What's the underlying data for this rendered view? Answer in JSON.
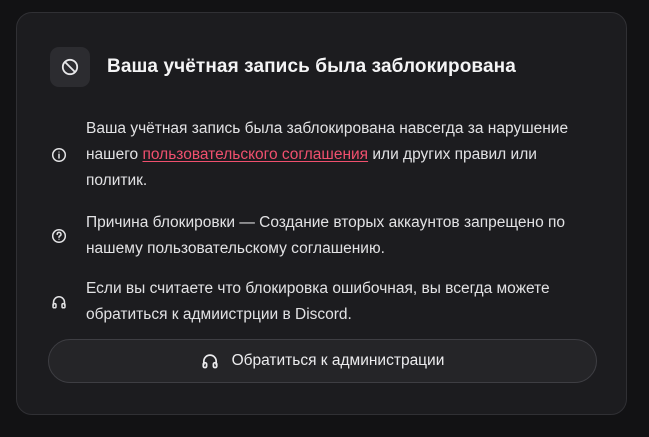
{
  "dialog": {
    "title": "Ваша учётная запись была заблокирована",
    "header_icon": "ban-icon",
    "items": [
      {
        "icon": "info-icon",
        "text_before": "Ваша учётная запись была заблокирована навсегда за нарушение нашего ",
        "link_text": "пользовательского соглашения",
        "text_after": " или других правил или политик."
      },
      {
        "icon": "question-icon",
        "text": "Причина блокировки — Создание вторых аккаунтов запрещено по нашему пользовательскому соглашению."
      },
      {
        "icon": "headphones-icon",
        "text": "Если вы считаете что блокировка ошибочная, вы всегда можете обратиться к адмиистрции в Discord."
      }
    ],
    "contact_button": {
      "icon": "headphones-icon",
      "label": "Обратиться к администрации"
    }
  },
  "colors": {
    "background": "#121214",
    "card": "#1c1c1f",
    "link": "#f0506e",
    "text": "#e2e2e4"
  }
}
